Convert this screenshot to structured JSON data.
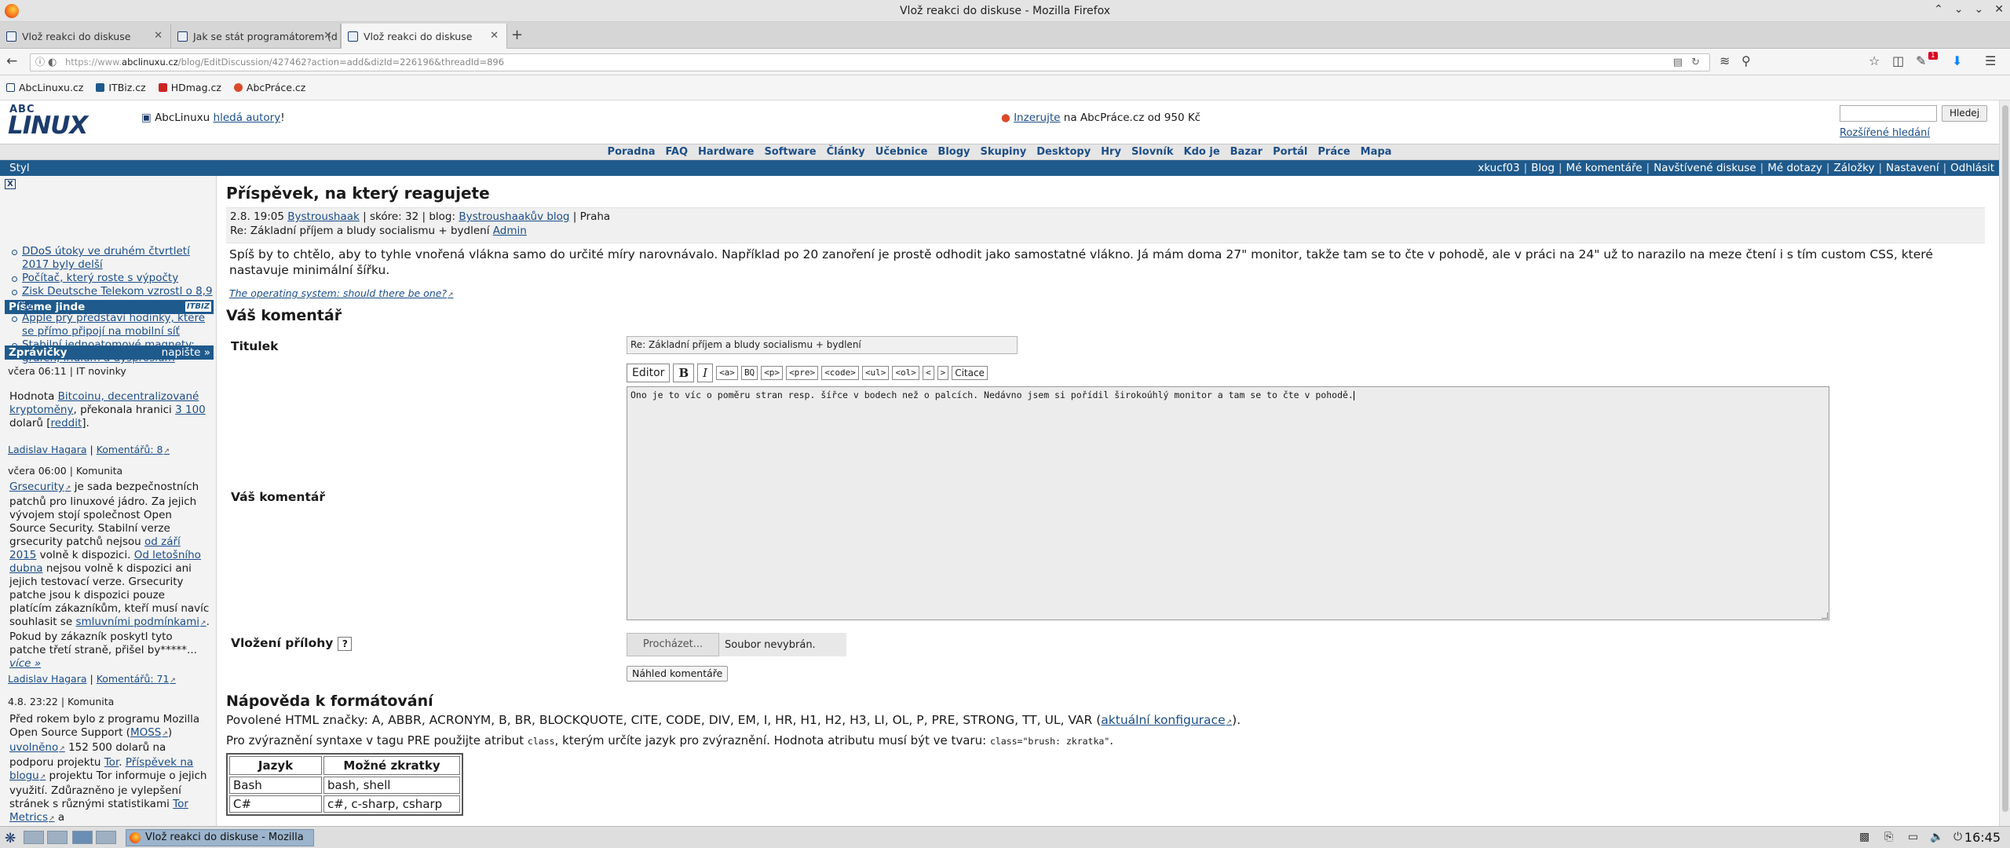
{
  "window": {
    "title": "Vlož reakci do diskuse - Mozilla Firefox"
  },
  "tabs": [
    {
      "label": "Vlož reakci do diskuse"
    },
    {
      "label": "Jak se stát programátorem (d"
    },
    {
      "label": "Vlož reakci do diskuse"
    }
  ],
  "url": {
    "scheme": "https://www.",
    "host": "abclinuxu.cz",
    "path": "/blog/EditDiscussion/427462?action=add&dizId=226196&threadId=896"
  },
  "bookmarks": [
    "AbcLinuxu.cz",
    "ITBiz.cz",
    "HDmag.cz",
    "AbcPráce.cz"
  ],
  "toolbar": {
    "download_badge": "1"
  },
  "site": {
    "logo_top": "ABC",
    "logo_main": "LINUX",
    "authors_prefix": "AbcLinuxu ",
    "authors_link": "hledá autory",
    "authors_suffix": "!",
    "ad_link": "Inzerujte",
    "ad_text": " na AbcPráce.cz od 950 Kč",
    "search_button": "Hledej",
    "search_advanced": "Rozšířené hledání",
    "nav": [
      "Poradna",
      "FAQ",
      "Hardware",
      "Software",
      "Články",
      "Učebnice",
      "Blogy",
      "Skupiny",
      "Desktopy",
      "Hry",
      "Slovník",
      "Kdo je",
      "Bazar",
      "Portál",
      "Práce",
      "Mapa"
    ],
    "styl": "Styl",
    "userlinks": [
      "xkucf03",
      "Blog",
      "Mé komentáře",
      "Navštívené diskuse",
      "Mé dotazy",
      "Záložky",
      "Nastavení",
      "Odhlásit"
    ]
  },
  "sidebar": {
    "close": "X",
    "piseme_title": "Píšeme jinde",
    "piseme_badge": "ITBIZ",
    "piseme_items": [
      "DDoS útoky ve druhém čtvrtletí 2017 byly delší",
      "Počítač, který roste s výpočty",
      "Zisk Deutsche Telekom vzrostl o 8,9 %",
      "Apple prý představí hodinky, které se přímo připojí na mobilní síť",
      "Stabilní jednoatomové magnety: grafen, iridium a dysprosium"
    ],
    "zpravicky_title": "Zprávičky",
    "zpravicky_action": "napište »",
    "news": [
      {
        "meta": "včera 06:11 | IT novinky",
        "author": "Ladislav Hagara",
        "comments": "Komentářů: 8"
      },
      {
        "meta": "včera 06:00 | Komunita",
        "author": "Ladislav Hagara",
        "comments": "Komentářů: 71"
      },
      {
        "meta": "4.8. 23:22 | Komunita"
      }
    ]
  },
  "main": {
    "post_title": "Příspěvek, na který reagujete",
    "post_meta_date": "2.8. 19:05 ",
    "post_meta_author": "Bystroushaak",
    "post_meta_score": " | skóre: 32 | blog: ",
    "post_meta_blog": "Bystroushaakův blog",
    "post_meta_city": " | Praha",
    "post_re": "Re: Základní příjem a bludy socialismu + bydlení ",
    "post_re_author": "Admin",
    "post_text": "Spíš by to chtělo, aby to tyhle vnořená vlákna samo do určité míry narovnávalo. Například po 20 zanoření je prostě odhodit jako samostatné vlákno. Já mám doma 27\" monitor, takže tam se to čte v pohodě, ale v práci na 24\" už to narazilo na meze čtení i s tím custom CSS, které nastavuje minimální šířku.",
    "signature": "The operating system: should there be one?",
    "comment_title": "Váš komentář",
    "label_titulek": "Titulek",
    "titulek_value": "Re: Základní příjem a bludy socialismu + bydlení",
    "editor_buttons": [
      "Editor",
      "B",
      "I",
      "<a>",
      "BQ",
      "<p>",
      "<pre>",
      "<code>",
      "<ul>",
      "<ol>",
      "<",
      ">",
      "Citace"
    ],
    "label_comment": "Váš komentář",
    "comment_value": "Ono je to víc o poměru stran resp. šířce v bodech než o palcích. Nedávno jsem si pořídil širokoúhlý monitor a tam se to čte v pohodě.",
    "label_attach": "Vložení přílohy",
    "attach_help": "?",
    "file_button": "Procházet...",
    "file_status": "Soubor nevybrán.",
    "preview_button": "Náhled komentáře",
    "help_title": "Nápověda k formátování",
    "allowed_tags": "Povolené HTML značky: A, ABBR, ACRONYM, B, BR, BLOCKQUOTE, CITE, CODE, DIV, EM, I, HR, H1, H2, H3, LI, OL, P, PRE, STRONG, TT, UL, VAR (",
    "allowed_link": "aktuální konfigurace",
    "allowed_end": ").",
    "pre_tip_1": "Pro zvýraznění syntaxe v tagu PRE použijte atribut ",
    "pre_tip_code1": "class",
    "pre_tip_2": ", kterým určíte jazyk pro zvýraznění. Hodnota atributu musí být ve tvaru: ",
    "pre_tip_code2": "class=\"brush: zkratka\"",
    "pre_tip_3": ".",
    "lang_table": {
      "headers": [
        "Jazyk",
        "Možné zkratky"
      ],
      "rows": [
        [
          "Bash",
          "bash, shell"
        ],
        [
          "C#",
          "c#, c-sharp, csharp"
        ]
      ]
    }
  },
  "taskbar": {
    "task": "Vlož reakci do diskuse - Mozilla Firefox",
    "clock": "16:45"
  }
}
